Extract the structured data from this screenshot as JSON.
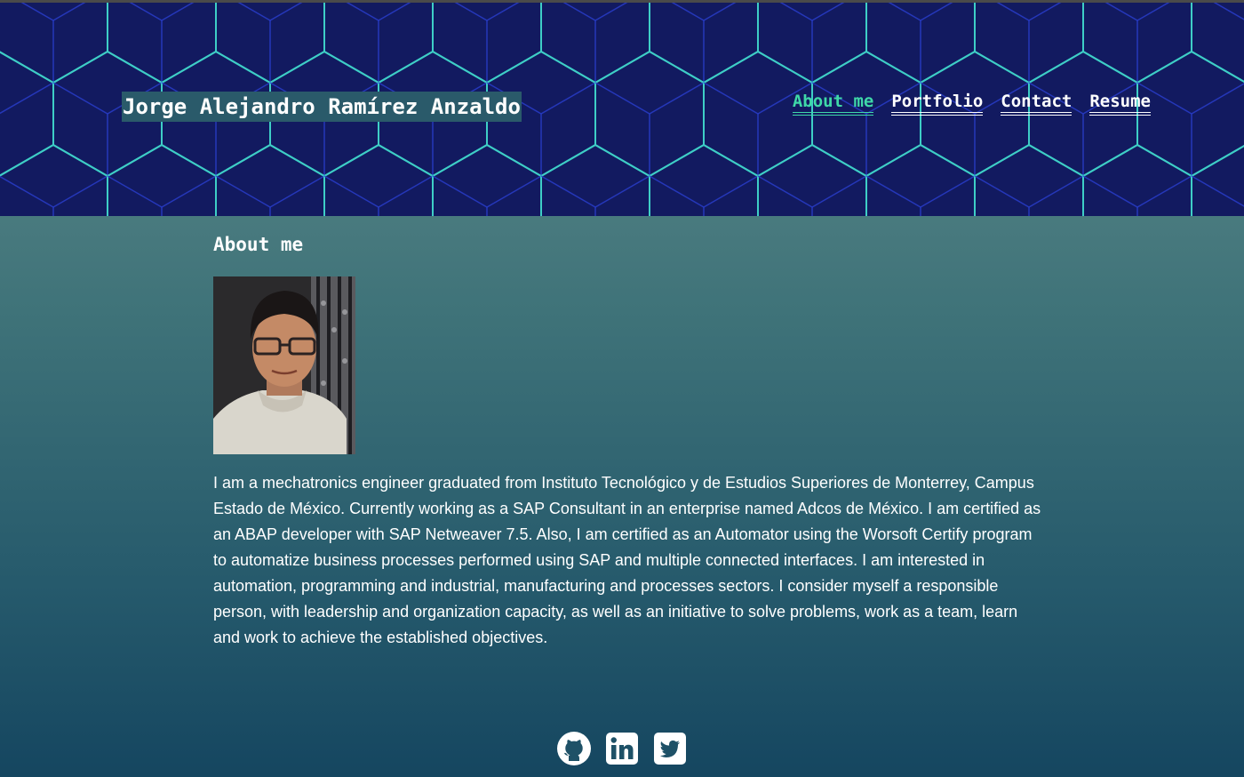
{
  "header": {
    "site_title": "Jorge Alejandro Ramírez Anzaldo",
    "nav": [
      {
        "label": "About me",
        "active": true
      },
      {
        "label": "Portfolio",
        "active": false
      },
      {
        "label": "Contact",
        "active": false
      },
      {
        "label": "Resume",
        "active": false
      }
    ]
  },
  "about": {
    "heading": "About me",
    "photo_icon": "profile-photo",
    "bio": "I am a mechatronics engineer graduated from Instituto Tecnológico y de Estudios Superiores de Monterrey, Campus Estado de México. Currently working as a SAP Consultant in an enterprise named Adcos de México. I am certified as an ABAP developer with SAP Netweaver 7.5. Also, I am certified as an Automator using the Worsoft Certify program to automatize business processes performed using SAP and multiple connected interfaces. I am interested in automation, programming and industrial, manufacturing and processes sectors. I consider myself a responsible person, with leadership and organization capacity, as well as an initiative to solve problems, work as a team, learn and work to achieve the established objectives."
  },
  "footer": {
    "social_icons": [
      "github-icon",
      "linkedin-icon",
      "twitter-icon"
    ]
  },
  "colors": {
    "header_bg": "#121a60",
    "pattern_line": "#3fd0c8",
    "nav_active": "#3fd8a8",
    "title_highlight": "#2a5a6a",
    "body_gradient_top": "#5f8a8b",
    "body_gradient_bottom": "#154660"
  }
}
